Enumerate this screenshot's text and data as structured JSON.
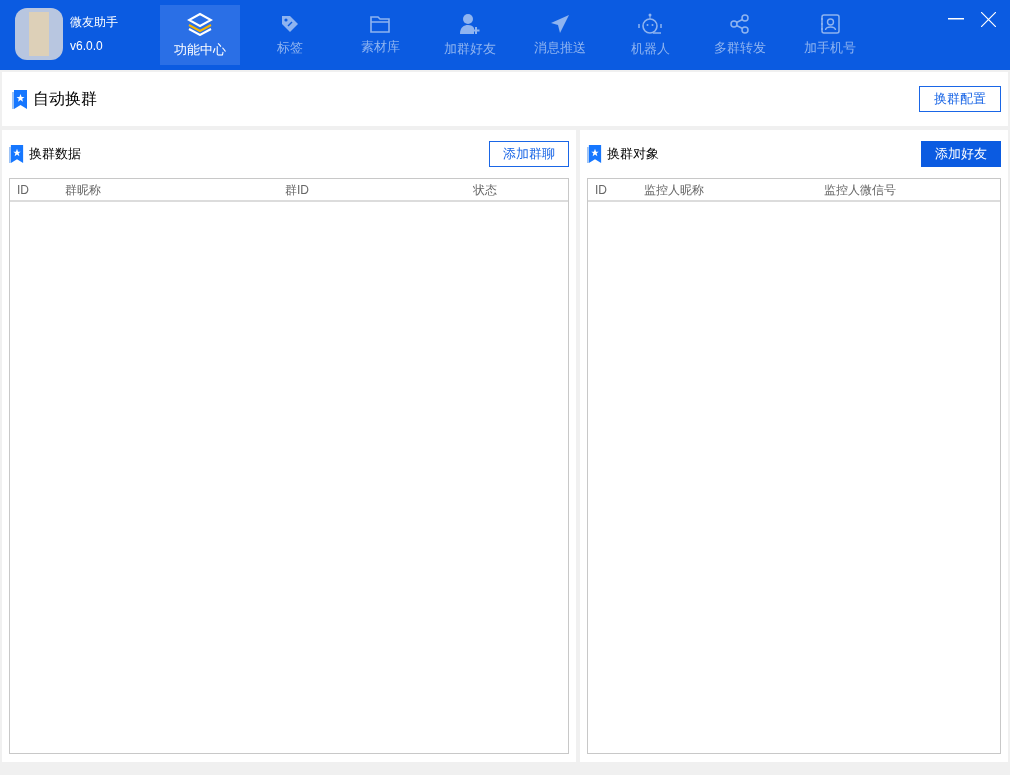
{
  "app": {
    "name": "微友助手",
    "version": "v6.0.0"
  },
  "nav": [
    {
      "label": "功能中心",
      "selected": true
    },
    {
      "label": "标签",
      "selected": false
    },
    {
      "label": "素材库",
      "selected": false
    },
    {
      "label": "加群好友",
      "selected": false
    },
    {
      "label": "消息推送",
      "selected": false
    },
    {
      "label": "机器人",
      "selected": false
    },
    {
      "label": "多群转发",
      "selected": false
    },
    {
      "label": "加手机号",
      "selected": false
    }
  ],
  "page": {
    "title": "自动换群",
    "button": "换群配置"
  },
  "panels": [
    {
      "title": "换群数据",
      "button": {
        "label": "添加群聊",
        "kind": "outline"
      },
      "columns": [
        "ID",
        "群昵称",
        "群ID",
        "状态"
      ]
    },
    {
      "title": "换群对象",
      "button": {
        "label": "添加好友",
        "kind": "filled"
      },
      "columns": [
        "ID",
        "监控人昵称",
        "监控人微信号"
      ]
    }
  ]
}
